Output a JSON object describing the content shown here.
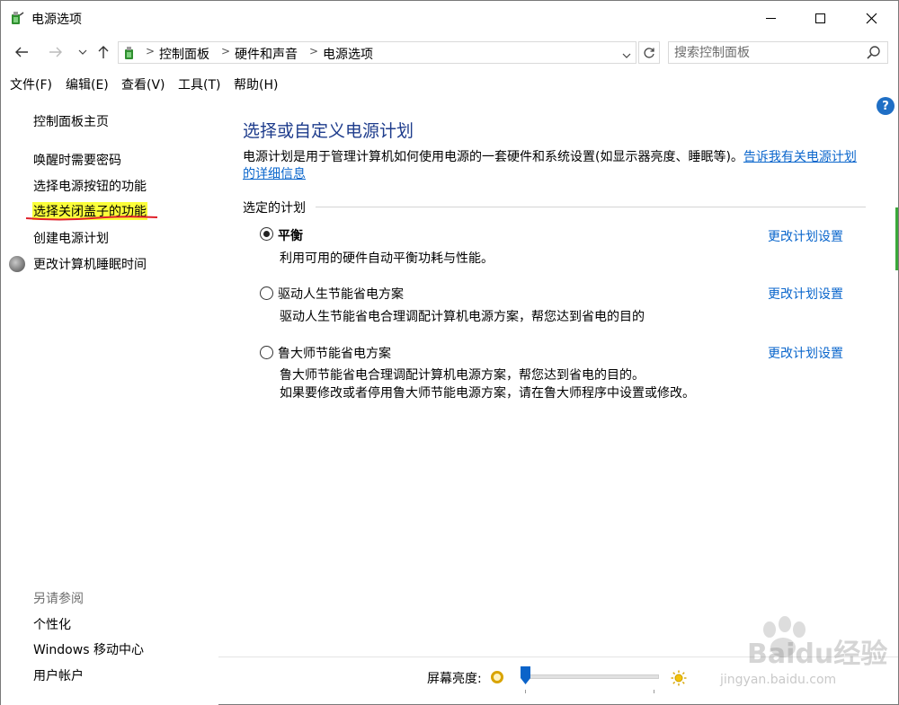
{
  "window": {
    "title": "电源选项",
    "minimize_icon": "minimize-icon",
    "maximize_icon": "maximize-icon",
    "close_icon": "close-icon"
  },
  "navigation": {
    "breadcrumbs": [
      "控制面板",
      "硬件和声音",
      "电源选项"
    ],
    "search_placeholder": "搜索控制面板"
  },
  "menu": {
    "items": [
      "文件(F)",
      "编辑(E)",
      "查看(V)",
      "工具(T)",
      "帮助(H)"
    ]
  },
  "sidebar": {
    "home": "控制面板主页",
    "links": [
      "唤醒时需要密码",
      "选择电源按钮的功能",
      "选择关闭盖子的功能",
      "创建电源计划",
      "更改计算机睡眠时间"
    ],
    "see_also_heading": "另请参阅",
    "see_also": [
      "个性化",
      "Windows 移动中心",
      "用户帐户"
    ]
  },
  "main": {
    "title": "选择或自定义电源计划",
    "description": "电源计划是用于管理计算机如何使用电源的一套硬件和系统设置(如显示器亮度、睡眠等)。",
    "description_link": "告诉我有关电源计划的详细信息",
    "section_label": "选定的计划",
    "plans": [
      {
        "name": "平衡",
        "selected": true,
        "description": [
          "利用可用的硬件自动平衡功耗与性能。"
        ],
        "change_link": "更改计划设置"
      },
      {
        "name": "驱动人生节能省电方案",
        "selected": false,
        "description": [
          "驱动人生节能省电合理调配计算机电源方案，帮您达到省电的目的"
        ],
        "change_link": "更改计划设置"
      },
      {
        "name": "鲁大师节能省电方案",
        "selected": false,
        "description": [
          "鲁大师节能省电合理调配计算机电源方案，帮您达到省电的目的。",
          "如果要修改或者停用鲁大师节能电源方案，请在鲁大师程序中设置或修改。"
        ],
        "change_link": "更改计划设置"
      }
    ]
  },
  "brightness": {
    "label": "屏幕亮度:",
    "level_fraction": 0.02
  },
  "watermark": {
    "text": "Baidu经验",
    "sub": "jingyan.baidu.com"
  },
  "colors": {
    "title_blue": "#1e3c8c",
    "link_blue": "#0a66cc",
    "highlight_yellow": "#fbff3a",
    "underline_red": "#e0202a"
  }
}
